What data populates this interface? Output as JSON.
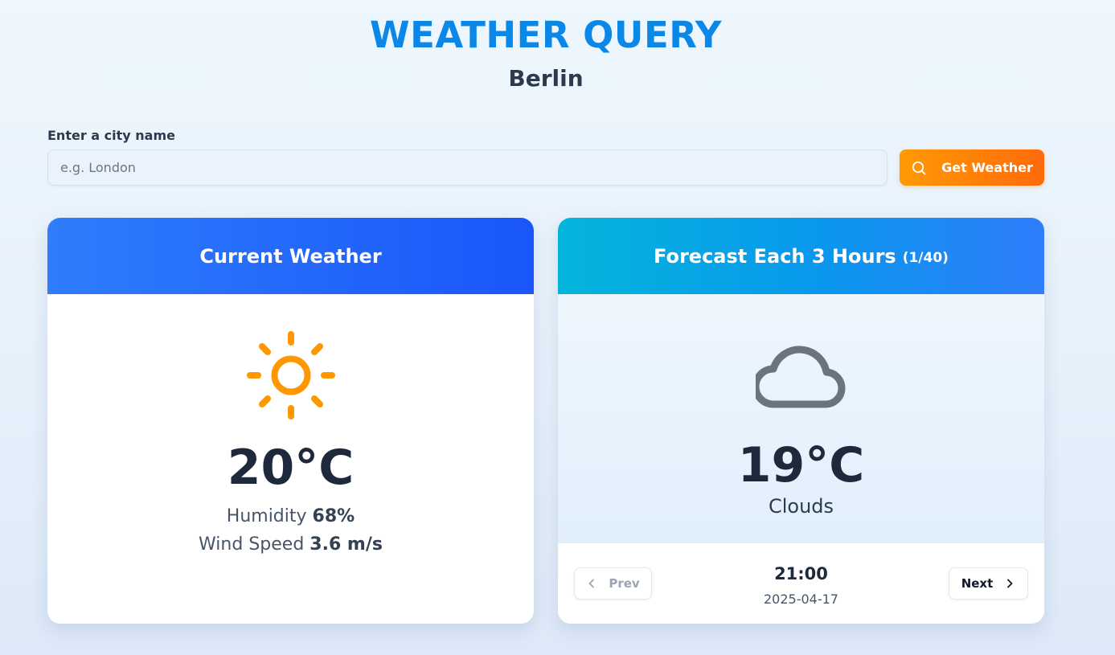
{
  "app": {
    "title": "WEATHER QUERY",
    "city": "Berlin"
  },
  "search": {
    "label": "Enter a city name",
    "placeholder": "e.g. London",
    "value": "",
    "button_label": "Get Weather",
    "button_icon": "search-icon"
  },
  "current": {
    "title": "Current Weather",
    "icon": "sun-icon",
    "temperature": "20°C",
    "humidity_label": "Humidity",
    "humidity_value": "68%",
    "wind_label": "Wind Speed",
    "wind_value": "3.6 m/s"
  },
  "forecast": {
    "title": "Forecast Each 3 Hours",
    "count": "(1/40)",
    "icon": "cloud-icon",
    "temperature": "19°C",
    "condition": "Clouds",
    "time": "21:00",
    "date": "2025-04-17",
    "prev_label": "Prev",
    "next_label": "Next"
  },
  "colors": {
    "title_blue": "#0b87e8",
    "button_orange": "#ff7a0a",
    "sun_orange": "#ff9800",
    "cloud_gray": "#6b7280"
  }
}
